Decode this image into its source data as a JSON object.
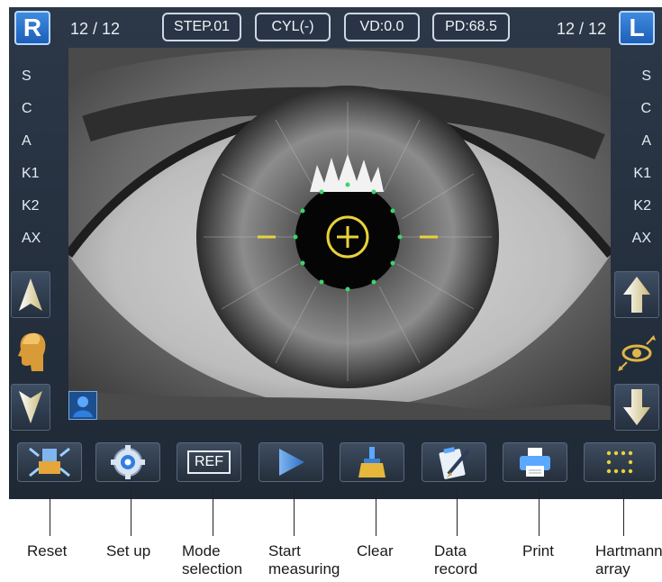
{
  "header": {
    "right_eye_badge": "R",
    "left_eye_badge": "L",
    "right_counter": "12 / 12",
    "left_counter": "12 / 12",
    "step": "STEP.01",
    "cyl": "CYL(-)",
    "vd": "VD:0.0",
    "pd": "PD:68.5"
  },
  "left_panel": {
    "rows": [
      "S",
      "C",
      "A",
      "K1",
      "K2",
      "AX"
    ]
  },
  "right_panel": {
    "rows": [
      "S",
      "C",
      "A",
      "K1",
      "K2",
      "AX"
    ]
  },
  "toolbar": {
    "buttons": [
      {
        "icon": "reset-icon"
      },
      {
        "icon": "gear-icon"
      },
      {
        "icon": "ref-icon",
        "text": "REF"
      },
      {
        "icon": "play-icon"
      },
      {
        "icon": "broom-icon"
      },
      {
        "icon": "clipboard-icon"
      },
      {
        "icon": "printer-icon"
      },
      {
        "icon": "dot-grid-icon"
      }
    ]
  },
  "captions": {
    "reset": "Reset",
    "set_up": "Set up",
    "mode_selection": "Mode\nselection",
    "start_measuring": "Start\nmeasuring",
    "clear": "Clear",
    "data_record": "Data\nrecord",
    "print": "Print",
    "hartmann_array": "Hartmann\narray"
  },
  "colors": {
    "panel_bg": "#24303e",
    "badge_blue": "#2a74d0",
    "reticle_yellow": "#e8d23a",
    "ring_dots_green": "#3fd36a"
  }
}
